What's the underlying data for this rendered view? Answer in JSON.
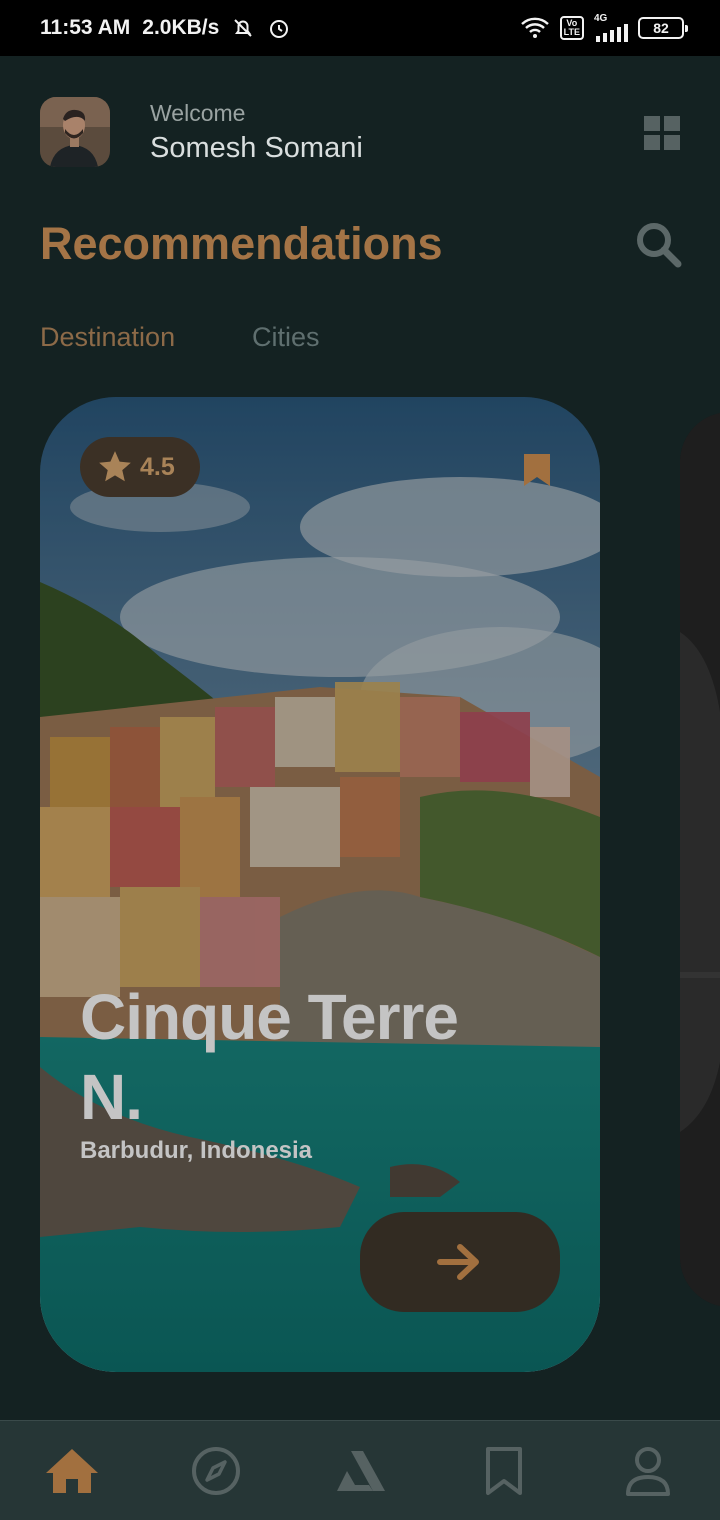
{
  "status_bar": {
    "time": "11:53 AM",
    "speed": "2.0KB/s",
    "volte_top": "Vo",
    "volte_bottom": "LTE",
    "network": "4G",
    "battery": "82"
  },
  "header": {
    "welcome": "Welcome",
    "user_name": "Somesh Somani",
    "menu_icon": "grid-icon"
  },
  "section": {
    "title": "Recommendations",
    "search_icon": "search-icon"
  },
  "tabs": [
    {
      "label": "Destination",
      "active": true
    },
    {
      "label": "Cities",
      "active": false
    }
  ],
  "card": {
    "rating": "4.5",
    "name": "Cinque Terre N.",
    "location": "Barbudur, Indonesia",
    "bookmark_icon": "bookmark-icon",
    "action_icon": "arrow-right-icon"
  },
  "bottom_nav": [
    {
      "icon": "home-icon",
      "active": true
    },
    {
      "icon": "compass-icon",
      "active": false
    },
    {
      "icon": "navigation-a-icon",
      "active": false
    },
    {
      "icon": "bookmark-icon",
      "active": false
    },
    {
      "icon": "profile-icon",
      "active": false
    }
  ],
  "colors": {
    "background": "#142222",
    "accent": "#a47446",
    "nav_background": "#263636"
  }
}
